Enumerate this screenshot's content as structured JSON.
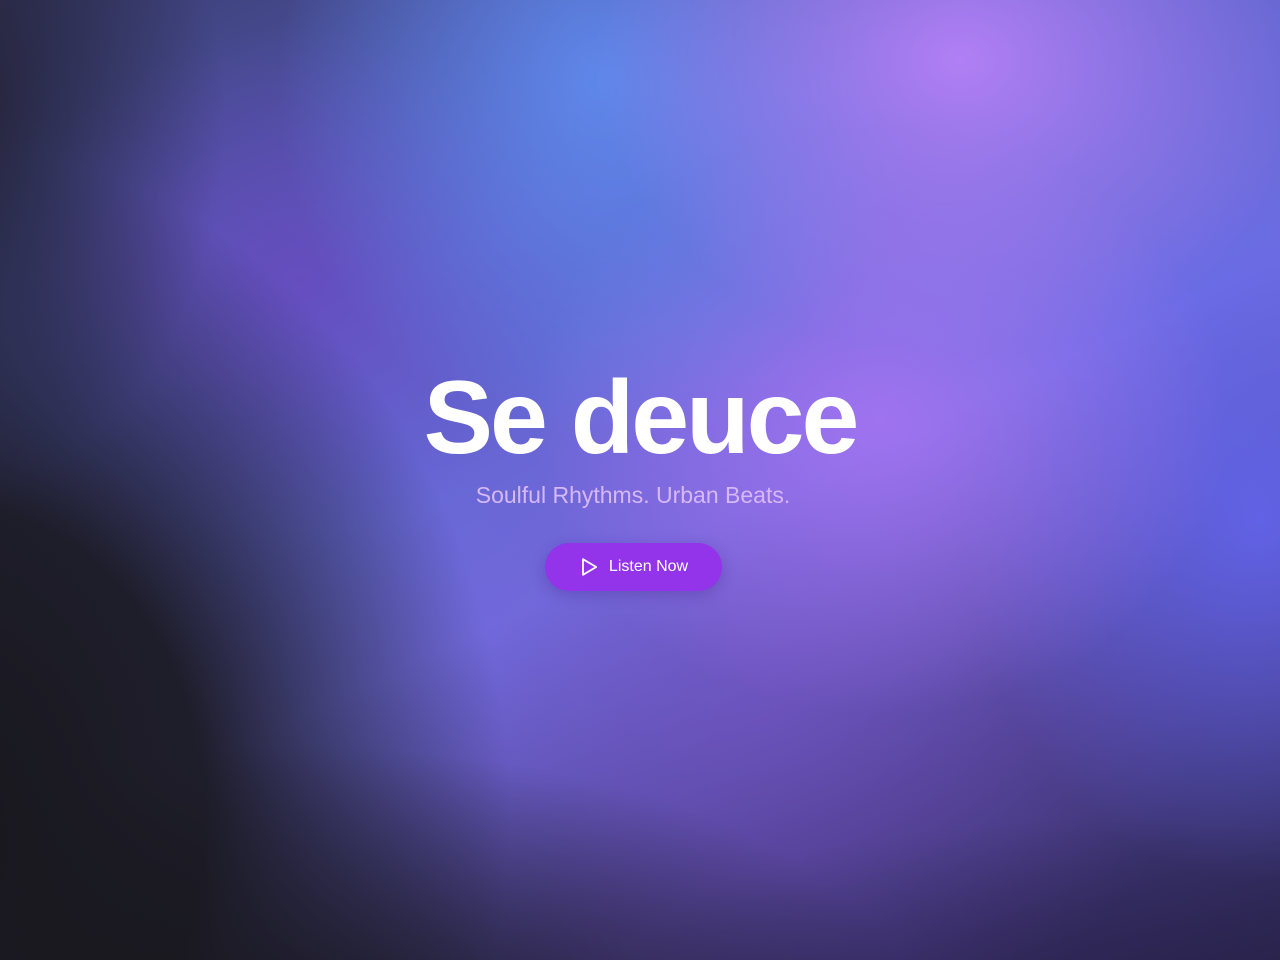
{
  "hero": {
    "title": "Se deuce",
    "tagline": "Soulful Rhythms. Urban Beats.",
    "cta": {
      "label": "Listen Now",
      "icon": "play-icon"
    }
  },
  "colors": {
    "accent": "#9333ea",
    "tagline": "#d7b8f6",
    "title": "#ffffff",
    "background_dark": "#19181c"
  }
}
